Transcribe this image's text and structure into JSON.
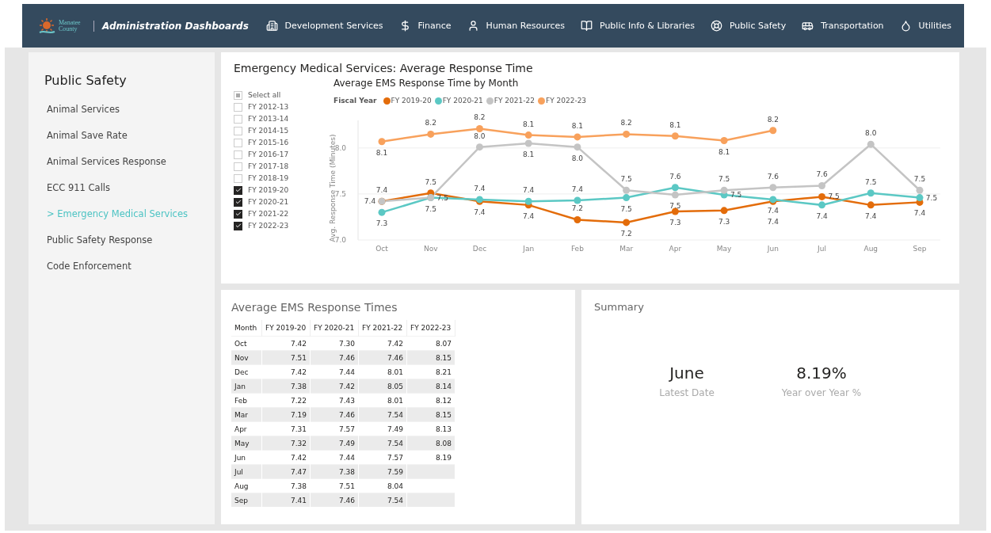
{
  "header": {
    "logo_text": "Manatee County",
    "title": "Administration Dashboards",
    "nav": [
      {
        "label": "Development Services"
      },
      {
        "label": "Finance"
      },
      {
        "label": "Human Resources"
      },
      {
        "label": "Public Info & Libraries"
      },
      {
        "label": "Public Safety"
      },
      {
        "label": "Transportation"
      },
      {
        "label": "Utilities"
      }
    ]
  },
  "sidebar": {
    "title": "Public Safety",
    "marker": ">",
    "items": [
      {
        "label": "Animal Services",
        "selected": false
      },
      {
        "label": "Animal Save Rate",
        "selected": false
      },
      {
        "label": "Animal Services Response",
        "selected": false
      },
      {
        "label": "ECC 911 Calls",
        "selected": false
      },
      {
        "label": "Emergency Medical Services",
        "selected": true
      },
      {
        "label": "Public Safety Response",
        "selected": false
      },
      {
        "label": "Code Enforcement",
        "selected": false
      }
    ]
  },
  "chart_card": {
    "title": "Emergency Medical Services: Average Response Time",
    "slicer": {
      "select_all": {
        "label": "Select all",
        "partial": true
      },
      "items": [
        {
          "label": "FY 2012-13",
          "checked": false
        },
        {
          "label": "FY 2013-14",
          "checked": false
        },
        {
          "label": "FY 2014-15",
          "checked": false
        },
        {
          "label": "FY 2015-16",
          "checked": false
        },
        {
          "label": "FY 2016-17",
          "checked": false
        },
        {
          "label": "FY 2017-18",
          "checked": false
        },
        {
          "label": "FY 2018-19",
          "checked": false
        },
        {
          "label": "FY 2019-20",
          "checked": true
        },
        {
          "label": "FY 2020-21",
          "checked": true
        },
        {
          "label": "FY 2021-22",
          "checked": true
        },
        {
          "label": "FY 2022-23",
          "checked": true
        }
      ]
    },
    "legend_title": "Fiscal Year",
    "chart_data": {
      "type": "line",
      "title": "Average EMS Response Time by Month",
      "ylabel": "Avg. Response Time (Minutes)",
      "categories": [
        "Oct",
        "Nov",
        "Dec",
        "Jan",
        "Feb",
        "Mar",
        "Apr",
        "May",
        "Jun",
        "Jul",
        "Aug",
        "Sep"
      ],
      "ylim": [
        7.0,
        8.3
      ],
      "yticks": [
        {
          "value": 7.0,
          "label": "7.0"
        },
        {
          "value": 7.5,
          "label": "7.5"
        },
        {
          "value": 8.0,
          "label": "8.0"
        }
      ],
      "legend": "top",
      "series": [
        {
          "name": "FY 2019-20",
          "color": "#e36c0a",
          "marker": "circle",
          "values": [
            7.42,
            7.51,
            7.42,
            7.38,
            7.22,
            7.19,
            7.31,
            7.32,
            7.42,
            7.47,
            7.38,
            7.41
          ],
          "value_labels": [
            "7.4",
            "7.5",
            "7.4",
            "7.4",
            "7.2",
            "7.2",
            "7.3",
            "7.3",
            "7.4",
            "7.5",
            "7.4",
            "7.4"
          ]
        },
        {
          "name": "FY 2020-21",
          "color": "#5bc8c4",
          "marker": "circle",
          "values": [
            7.3,
            7.46,
            7.44,
            7.42,
            7.43,
            7.46,
            7.57,
            7.49,
            7.44,
            7.38,
            7.51,
            7.46
          ],
          "value_labels": [
            "7.3",
            "7.5",
            "7.4",
            "7.4",
            "7.4",
            "7.5",
            "7.6",
            "7.5",
            "7.4",
            "7.4",
            "7.5",
            "7.5"
          ]
        },
        {
          "name": "FY 2021-22",
          "color": "#c4c4c4",
          "marker": "circle",
          "values": [
            7.42,
            7.46,
            8.01,
            8.05,
            8.01,
            7.54,
            7.49,
            7.54,
            7.57,
            7.59,
            8.04,
            7.54
          ],
          "value_labels": [
            "7.4",
            "7.5",
            "8.0",
            "8.1",
            "8.0",
            "7.5",
            "7.5",
            "7.5",
            "7.6",
            "7.6",
            "8.0",
            "7.5"
          ]
        },
        {
          "name": "FY 2022-23",
          "color": "#f8a15c",
          "marker": "circle",
          "values": [
            8.07,
            8.15,
            8.21,
            8.14,
            8.12,
            8.15,
            8.13,
            8.08,
            8.19,
            null,
            null,
            null
          ],
          "value_labels": [
            "8.1",
            "8.2",
            "8.2",
            "8.1",
            "8.1",
            "8.2",
            "8.1",
            "8.1",
            "8.2",
            null,
            null,
            null
          ]
        }
      ]
    }
  },
  "table": {
    "title": "Average EMS Response Times",
    "columns": [
      "Month",
      "FY 2019-20",
      "FY 2020-21",
      "FY 2021-22",
      "FY 2022-23"
    ],
    "rows": [
      [
        "Oct",
        "7.42",
        "7.30",
        "7.42",
        "8.07"
      ],
      [
        "Nov",
        "7.51",
        "7.46",
        "7.46",
        "8.15"
      ],
      [
        "Dec",
        "7.42",
        "7.44",
        "8.01",
        "8.21"
      ],
      [
        "Jan",
        "7.38",
        "7.42",
        "8.05",
        "8.14"
      ],
      [
        "Feb",
        "7.22",
        "7.43",
        "8.01",
        "8.12"
      ],
      [
        "Mar",
        "7.19",
        "7.46",
        "7.54",
        "8.15"
      ],
      [
        "Apr",
        "7.31",
        "7.57",
        "7.49",
        "8.13"
      ],
      [
        "May",
        "7.32",
        "7.49",
        "7.54",
        "8.08"
      ],
      [
        "Jun",
        "7.42",
        "7.44",
        "7.57",
        "8.19"
      ],
      [
        "Jul",
        "7.47",
        "7.38",
        "7.59",
        ""
      ],
      [
        "Aug",
        "7.38",
        "7.51",
        "8.04",
        ""
      ],
      [
        "Sep",
        "7.41",
        "7.46",
        "7.54",
        ""
      ]
    ]
  },
  "summary": {
    "title": "Summary",
    "cards": [
      {
        "value": "June",
        "label": "Latest Date"
      },
      {
        "value": "8.19%",
        "label": "Year over Year %"
      }
    ]
  }
}
